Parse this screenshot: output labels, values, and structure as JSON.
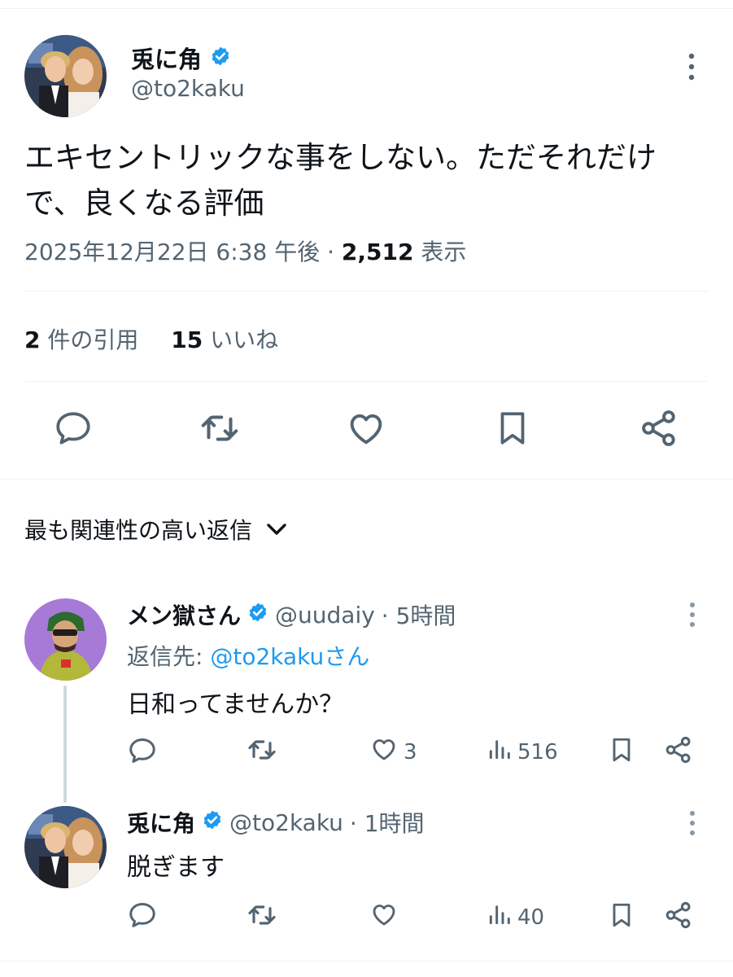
{
  "main_tweet": {
    "name": "兎に角",
    "handle": "@to2kaku",
    "text": "エキセントリックな事をしない。ただそれだけで、良くなる評価",
    "timestamp": "2025年12月22日 6:38 午後",
    "separator": "·",
    "views_count": "2,512",
    "views_label": "表示",
    "quotes_count": "2",
    "quotes_label": "件の引用",
    "likes_count": "15",
    "likes_label": "いいね",
    "icons": [
      "reply-icon",
      "retweet-icon",
      "like-icon",
      "bookmark-icon",
      "share-icon"
    ]
  },
  "sort": {
    "label": "最も関連性の高い返信",
    "icon": "chevron-down-icon"
  },
  "replies": [
    {
      "name": "メン獄さん",
      "handle": "@uudaiy",
      "time": "· 5時間",
      "reply_to_prefix": "返信先: ",
      "reply_to_handle": "@to2kakuさん",
      "text": "日和ってませんか？",
      "likes": "3",
      "views": "516"
    },
    {
      "name": "兎に角",
      "handle": "@to2kaku",
      "time": "· 1時間",
      "text": "脱ぎます",
      "likes": "",
      "views": "40"
    }
  ],
  "colors": {
    "text": "#0f1419",
    "secondary": "#536471",
    "accent": "#1d9bf0",
    "divider": "#eff3f4",
    "thread": "#cfd9de"
  }
}
